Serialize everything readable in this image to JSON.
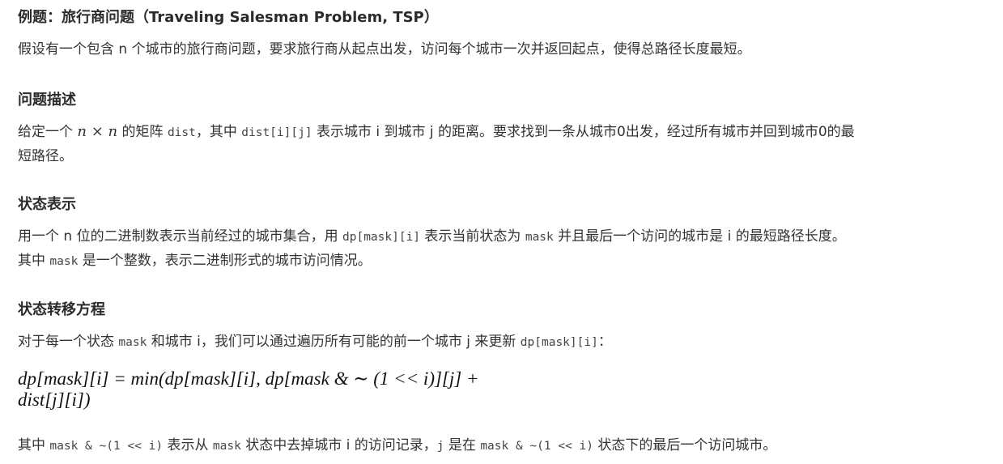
{
  "example": {
    "title": "例题：旅行商问题（Traveling Salesman Problem, TSP）",
    "intro": "假设有一个包含 n 个城市的旅行商问题，要求旅行商从起点出发，访问每个城市一次并返回起点，使得总路径长度最短。"
  },
  "problem": {
    "heading": "问题描述",
    "line1_a": "给定一个 ",
    "line1_math": "n × n",
    "line1_b": " 的矩阵 ",
    "line1_code1": "dist",
    "line1_c": "，其中 ",
    "line1_code2": "dist[i][j]",
    "line1_d": " 表示城市 i 到城市 j 的距离。要求找到一条从城市0出发，经过所有城市并回到城市0的最",
    "line2": "短路径。"
  },
  "state": {
    "heading": "状态表示",
    "line1_a": "用一个 n 位的二进制数表示当前经过的城市集合，用 ",
    "line1_code1": "dp[mask][i]",
    "line1_b": " 表示当前状态为 ",
    "line1_code2": "mask",
    "line1_c": " 并且最后一个访问的城市是 i 的最短路径长度。",
    "line2_a": "其中 ",
    "line2_code": "mask",
    "line2_b": " 是一个整数，表示二进制形式的城市访问情况。"
  },
  "transition": {
    "heading": "状态转移方程",
    "line1_a": "对于每一个状态 ",
    "line1_code1": "mask",
    "line1_b": " 和城市 i，我们可以通过遍历所有可能的前一个城市 j 来更新 ",
    "line1_code2": "dp[mask][i]",
    "line1_c": "：",
    "formula_line1": "dp[mask][i] = min(dp[mask][i], dp[mask & ∼ (1 << i)][j] +",
    "formula_line2": "dist[j][i])"
  },
  "note": {
    "a": "其中 ",
    "code1": "mask & ~(1 << i)",
    "b": " 表示从 ",
    "code2": "mask",
    "c": " 状态中去掉城市 i 的访问记录，",
    "code3": "j",
    "d": " 是在 ",
    "code4": "mask & ~(1 << i)",
    "e": " 状态下的最后一个访问城市。"
  }
}
